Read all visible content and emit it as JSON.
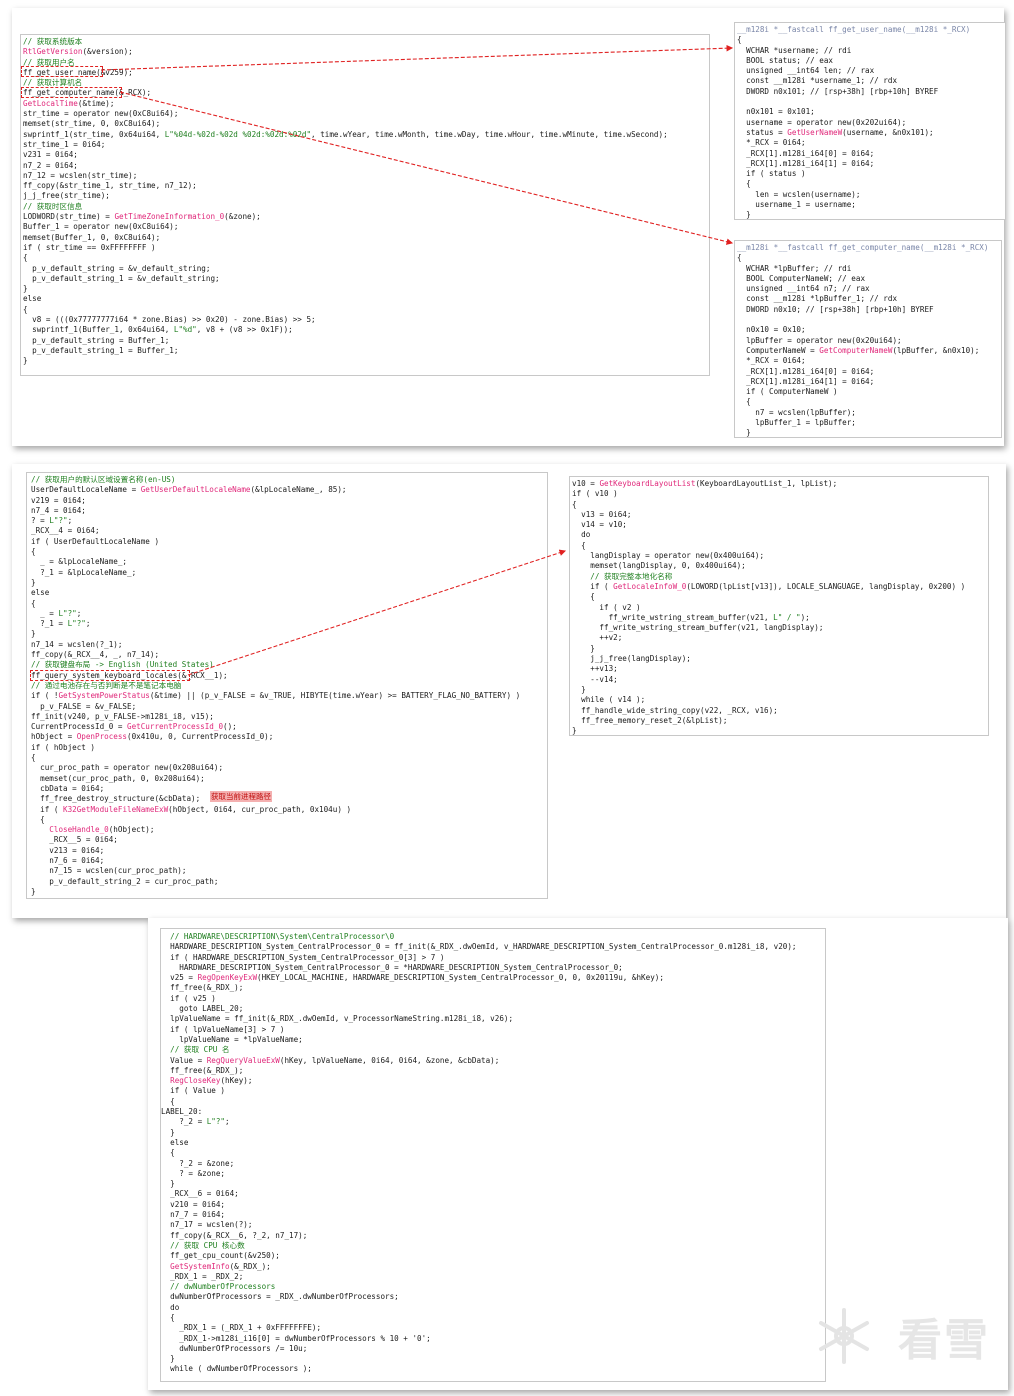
{
  "shot1": {
    "left_lines": [
      "// 获取系统版本",
      "RtlGetVersion(&version);",
      "// 获取用户名",
      "ff_get_user_name(&v259);",
      "// 获取计算机名",
      "ff_get_computer_name(&_RCX);",
      "GetLocalTime(&time);",
      "str_time = operator new(0xC8ui64);",
      "memset(str_time, 0, 0xC8ui64);",
      "swprintf_1(str_time, 0x64ui64, L\"%04d-%02d-%02d %02d:%02d:%02d\", time.wYear, time.wMonth, time.wDay, time.wHour, time.wMinute, time.wSecond);",
      "str_time_1 = 0i64;",
      "v231 = 0i64;",
      "n7_2 = 0i64;",
      "n7_12 = wcslen(str_time);",
      "ff_copy(&str_time_1, str_time, n7_12);",
      "j_j_free(str_time);",
      "// 获取时区信息",
      "LODWORD(str_time) = GetTimeZoneInformation_0(&zone);",
      "Buffer_1 = operator new(0xC8ui64);",
      "memset(Buffer_1, 0, 0xC8ui64);",
      "if ( str_time == 0xFFFFFFFF )",
      "{",
      "  p_v_default_string = &v_default_string;",
      "  p_v_default_string_1 = &v_default_string;",
      "}",
      "else",
      "{",
      "  v8 = (((0x77777777i64 * zone.Bias) >> 0x20) - zone.Bias) >> 5;",
      "  swprintf_1(Buffer_1, 0x64ui64, L\"%d\", v8 + (v8 >> 0x1F));",
      "  p_v_default_string = Buffer_1;",
      "  p_v_default_string_1 = Buffer_1;",
      "}"
    ],
    "user_lines": [
      "__m128i *__fastcall ff_get_user_name(__m128i *_RCX)",
      "{",
      "  WCHAR *username; // rdi",
      "  BOOL status; // eax",
      "  unsigned __int64 len; // rax",
      "  const __m128i *username_1; // rdx",
      "  DWORD n0x101; // [rsp+38h] [rbp+10h] BYREF",
      "",
      "  n0x101 = 0x101;",
      "  username = operator new(0x202ui64);",
      "  status = GetUserNameW(username, &n0x101);",
      "  *_RCX = 0i64;",
      "  _RCX[1].m128i_i64[0] = 0i64;",
      "  _RCX[1].m128i_i64[1] = 0i64;",
      "  if ( status )",
      "  {",
      "    len = wcslen(username);",
      "    username_1 = username;",
      "  }"
    ],
    "computer_lines": [
      "__m128i *__fastcall ff_get_computer_name(__m128i *_RCX)",
      "{",
      "  WCHAR *lpBuffer; // rdi",
      "  BOOL ComputerNameW; // eax",
      "  unsigned __int64 n7; // rax",
      "  const __m128i *lpBuffer_1; // rdx",
      "  DWORD n0x10; // [rsp+38h] [rbp+10h] BYREF",
      "",
      "  n0x10 = 0x10;",
      "  lpBuffer = operator new(0x20ui64);",
      "  ComputerNameW = GetComputerNameW(lpBuffer, &n0x10);",
      "  *_RCX = 0i64;",
      "  _RCX[1].m128i_i64[0] = 0i64;",
      "  _RCX[1].m128i_i64[1] = 0i64;",
      "  if ( ComputerNameW )",
      "  {",
      "    n7 = wcslen(lpBuffer);",
      "    lpBuffer_1 = lpBuffer;",
      "  }"
    ]
  },
  "shot2": {
    "left_lines": [
      "// 获取用户的默认区域设置名称(en-US)",
      "UserDefaultLocaleName = GetUserDefaultLocaleName(&lpLocaleName_, 85);",
      "v219 = 0i64;",
      "n7_4 = 0i64;",
      "? = L\"?\";",
      "_RCX__4 = 0i64;",
      "if ( UserDefaultLocaleName )",
      "{",
      "  _ = &lpLocaleName_;",
      "  ?_1 = &lpLocaleName_;",
      "}",
      "else",
      "{",
      "  _ = L\"?\";",
      "  ?_1 = L\"?\";",
      "}",
      "n7_14 = wcslen(?_1);",
      "ff_copy(&_RCX__4, _, n7_14);",
      "// 获取键盘布局 -> English (United States)",
      "ff_query_system_keyboard_locales(&_RCX__1);",
      "// 通过电池存在与否判断是不是笔记本电脑",
      "if ( !GetSystemPowerStatus(&time) || (p_v_FALSE = &v_TRUE, HIBYTE(time.wYear) >= BATTERY_FLAG_NO_BATTERY) )",
      "  p_v_FALSE = &v_FALSE;",
      "ff_init(v240, p_v_FALSE->m128i_i8, v15);",
      "CurrentProcessId_0 = GetCurrentProcessId_0();",
      "hObject = OpenProcess(0x410u, 0, CurrentProcessId_0);",
      "if ( hObject )",
      "{",
      "  cur_proc_path = operator new(0x208ui64);",
      "  memset(cur_proc_path, 0, 0x208ui64);",
      "  cbData = 0i64;",
      "  ff_free_destroy_structure(&cbData);",
      "  if ( K32GetModuleFileNameExW(hObject, 0i64, cur_proc_path, 0x104u) )",
      "  {",
      "    CloseHandle_0(hObject);",
      "    _RCX__5 = 0i64;",
      "    v213 = 0i64;",
      "    n7_6 = 0i64;",
      "    n7_15 = wcslen(cur_proc_path);",
      "    p_v_default_string_2 = cur_proc_path;",
      "}"
    ],
    "right_lines": [
      "v10 = GetKeyboardLayoutList(KeyboardLayoutList_1, lpList);",
      "if ( v10 )",
      "{",
      "  v13 = 0i64;",
      "  v14 = v10;",
      "  do",
      "  {",
      "    langDisplay = operator new(0x400ui64);",
      "    memset(langDisplay, 0, 0x400ui64);",
      "    // 获取完整本地化名称",
      "    if ( GetLocaleInfoW_0(LOWORD(lpList[v13]), LOCALE_SLANGUAGE, langDisplay, 0x200) )",
      "    {",
      "      if ( v2 )",
      "        ff_write_wstring_stream_buffer(v21, L\" / \");",
      "      ff_write_wstring_stream_buffer(v21, langDisplay);",
      "      ++v2;",
      "    }",
      "    j_j_free(langDisplay);",
      "    ++v13;",
      "    --v14;",
      "  }",
      "  while ( v14 );",
      "  ff_handle_wide_string_copy(v22, _RCX, v16);",
      "  ff_free_memory_reset_2(&lpList);",
      "}"
    ],
    "callout": "获取当前进程路径"
  },
  "shot3": {
    "lines": [
      "  // HARDWARE\\DESCRIPTION\\System\\CentralProcessor\\0",
      "  HARDWARE_DESCRIPTION_System_CentralProcessor_0 = ff_init(&_RDX_.dwOemId, v_HARDWARE_DESCRIPTION_System_CentralProcessor_0.m128i_i8, v20);",
      "  if ( HARDWARE_DESCRIPTION_System_CentralProcessor_0[3] > 7 )",
      "    HARDWARE_DESCRIPTION_System_CentralProcessor_0 = *HARDWARE_DESCRIPTION_System_CentralProcessor_0;",
      "  v25 = RegOpenKeyExW(HKEY_LOCAL_MACHINE, HARDWARE_DESCRIPTION_System_CentralProcessor_0, 0, 0x20119u, &hKey);",
      "  ff_free(&_RDX_);",
      "  if ( v25 )",
      "    goto LABEL_20;",
      "  lpValueName = ff_init(&_RDX_.dwOemId, v_ProcessorNameString.m128i_i8, v26);",
      "  if ( lpValueName[3] > 7 )",
      "    lpValueName = *lpValueName;",
      "  // 获取 CPU 名",
      "  Value = RegQueryValueExW(hKey, lpValueName, 0i64, 0i64, &zone, &cbData);",
      "  ff_free(&_RDX_);",
      "  RegCloseKey(hKey);",
      "  if ( Value )",
      "  {",
      "LABEL_20:",
      "    ?_2 = L\"?\";",
      "  }",
      "  else",
      "  {",
      "    ?_2 = &zone;",
      "    ? = &zone;",
      "  }",
      "  _RCX__6 = 0i64;",
      "  v210 = 0i64;",
      "  n7_7 = 0i64;",
      "  n7_17 = wcslen(?);",
      "  ff_copy(&_RCX__6, ?_2, n7_17);",
      "  // 获取 CPU 核心数",
      "  ff_get_cpu_count(&v250);",
      "  GetSystemInfo(&_RDX_);",
      "  _RDX_1 = _RDX_2;",
      "  // dwNumberOfProcessors",
      "  dwNumberOfProcessors = _RDX_.dwNumberOfProcessors;",
      "  do",
      "  {",
      "    _RDX_1 = (_RDX_1 + 0xFFFFFFFE);",
      "    _RDX_1->m128i_i16[0] = dwNumberOfProcessors % 10 + '0';",
      "    dwNumberOfProcessors /= 10u;",
      "  }",
      "  while ( dwNumberOfProcessors );"
    ]
  },
  "watermark": "看雪",
  "colors": {
    "comment": "#1f7f1f",
    "function": "#2b2bcc",
    "variable": "#7a86a8",
    "import": "#e0287a",
    "highlight_red": "#e02020"
  }
}
